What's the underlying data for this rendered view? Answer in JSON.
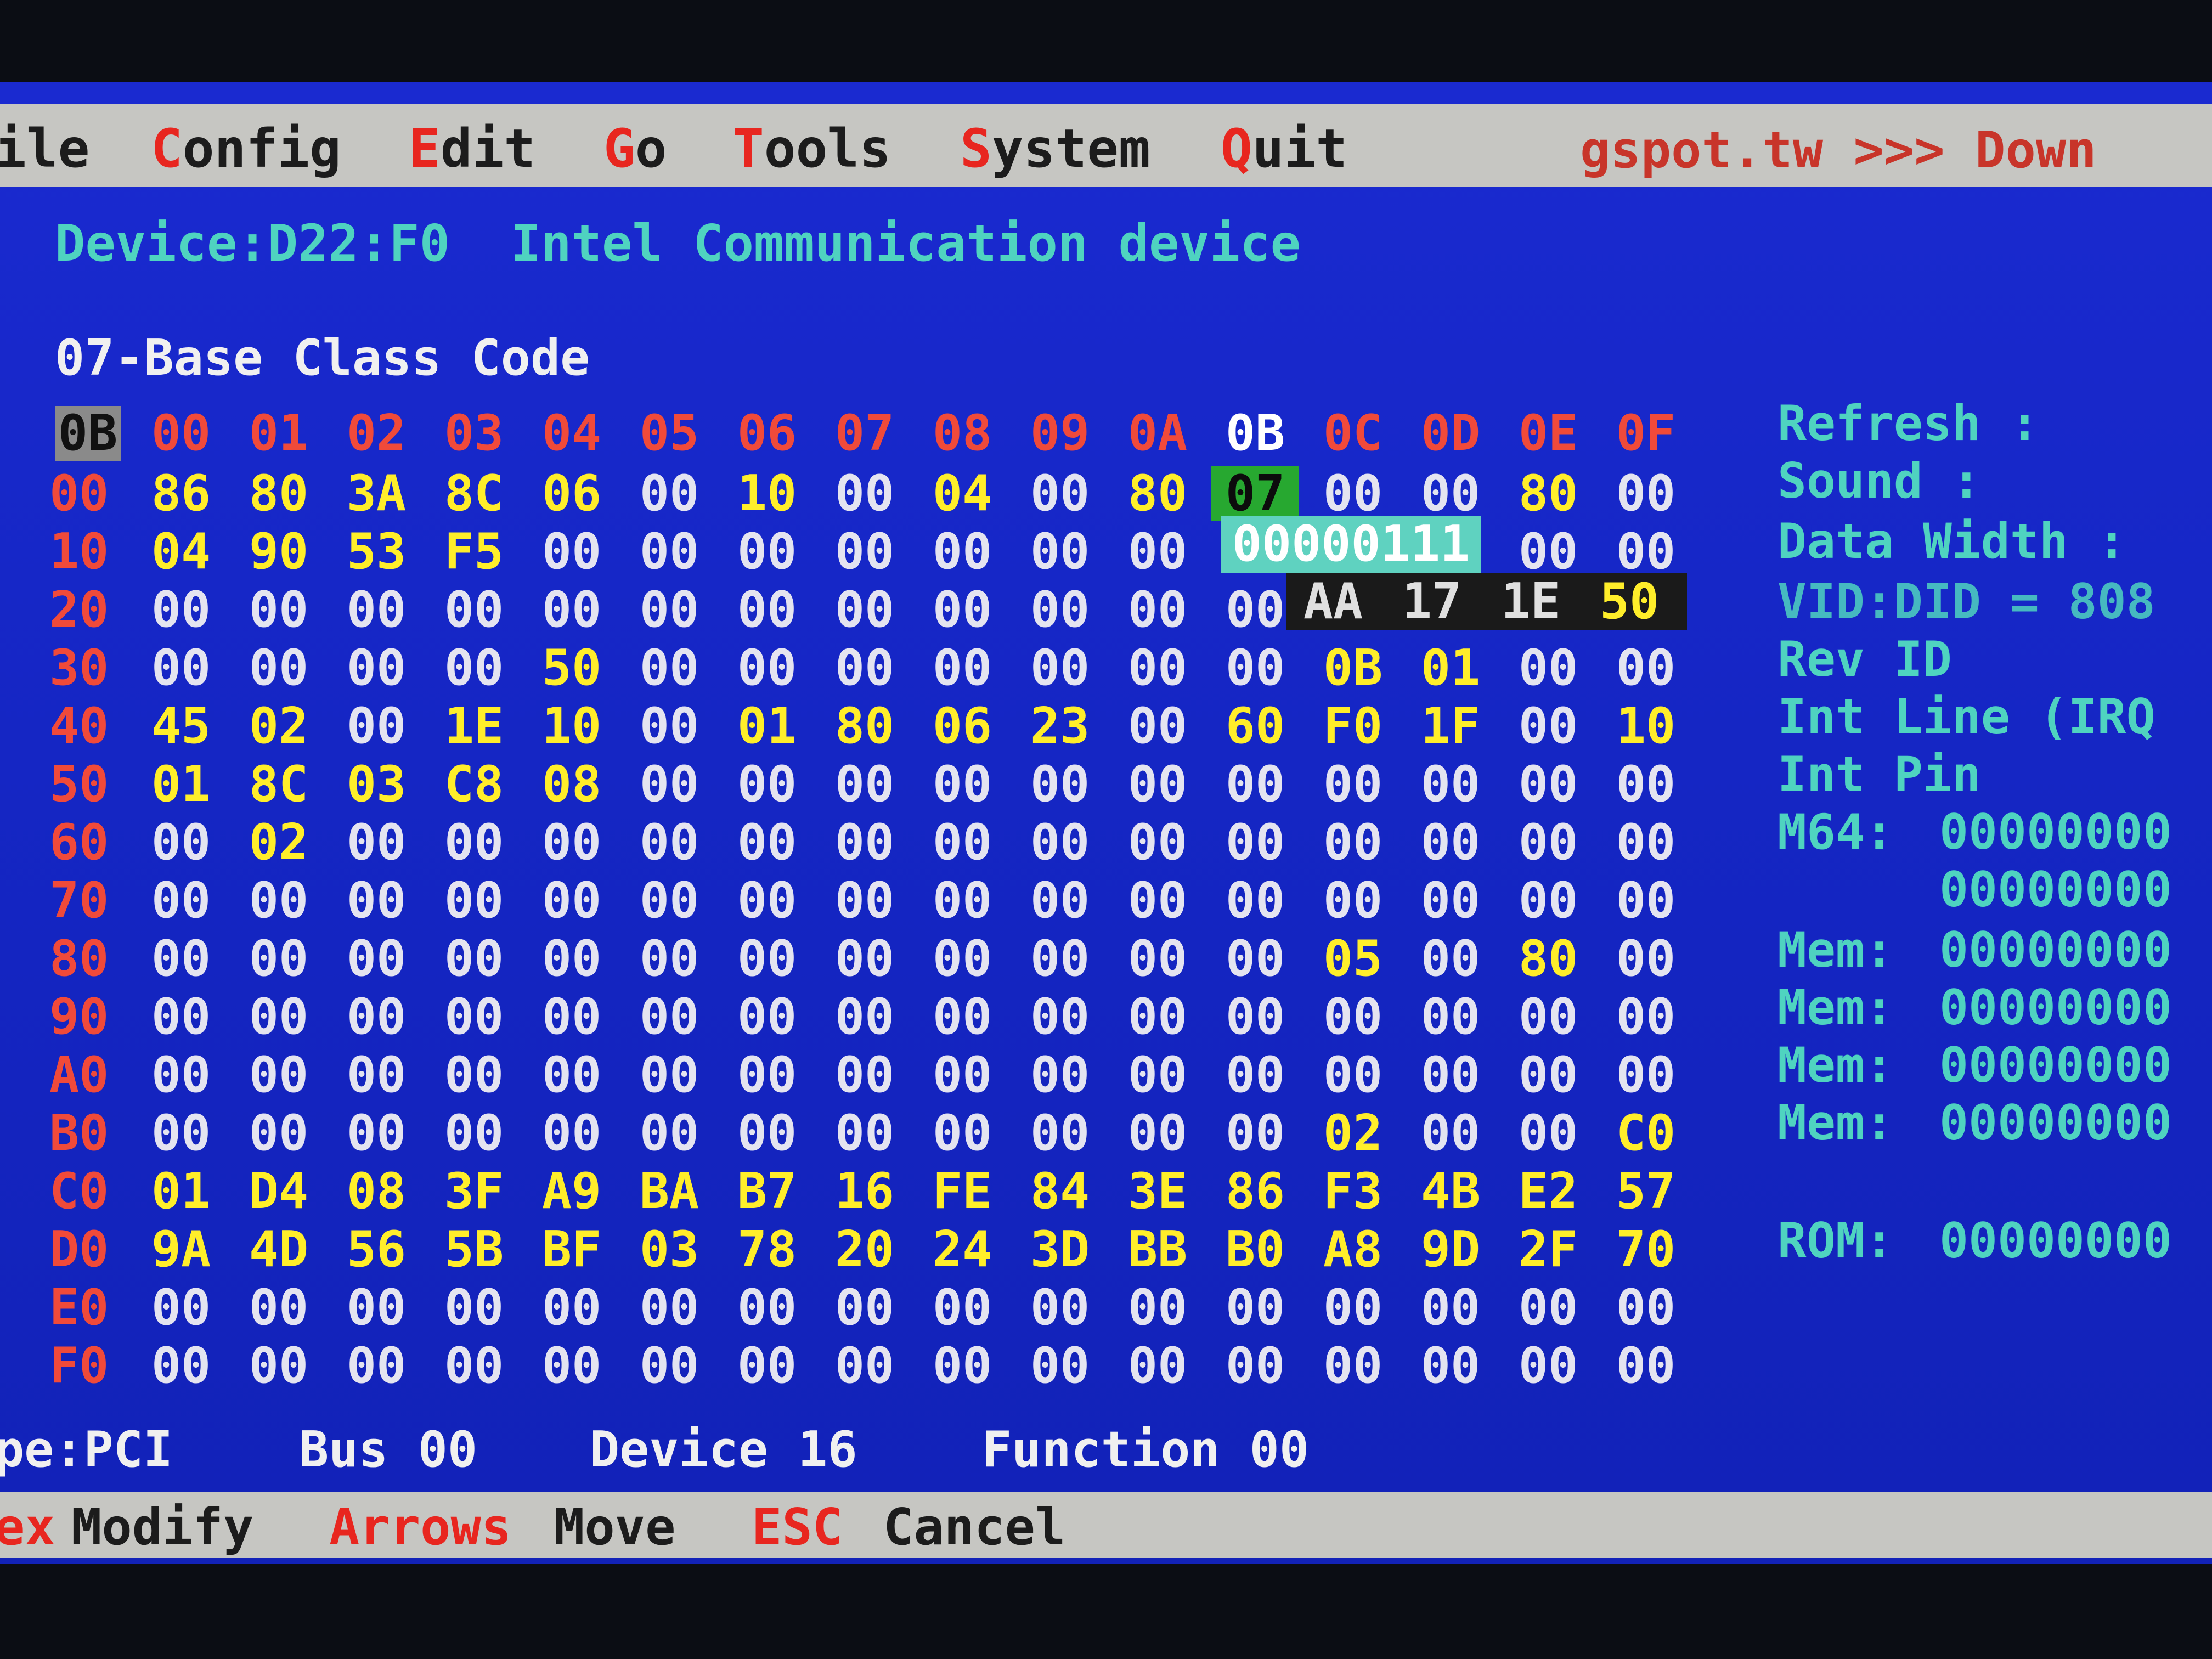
{
  "menu": {
    "items": [
      {
        "hot": "",
        "rest": "ile"
      },
      {
        "hot": "C",
        "rest": "onfig"
      },
      {
        "hot": "E",
        "rest": "dit"
      },
      {
        "hot": "G",
        "rest": "o"
      },
      {
        "hot": "T",
        "rest": "ools"
      },
      {
        "hot": "S",
        "rest": "ystem"
      },
      {
        "hot": "Q",
        "rest": "uit"
      }
    ],
    "brand": "gspot.tw",
    "brand_arrows": ">>>",
    "brand_tail": "Down"
  },
  "device": {
    "id": "Device:D22:F0",
    "vendor": "Intel",
    "description": "Communication device"
  },
  "register_title": "07-Base Class Code",
  "grid": {
    "selected_offset": "0B",
    "column_headers": [
      "00",
      "01",
      "02",
      "03",
      "04",
      "05",
      "06",
      "07",
      "08",
      "09",
      "0A",
      "0B",
      "0C",
      "0D",
      "0E",
      "0F"
    ],
    "rows": [
      {
        "label": "00",
        "cells": [
          "86",
          "80",
          "3A",
          "8C",
          "06",
          "00",
          "10",
          "00",
          "04",
          "00",
          "80",
          "07",
          "00",
          "00",
          "80",
          "00"
        ]
      },
      {
        "label": "10",
        "cells": [
          "04",
          "90",
          "53",
          "F5",
          "00",
          "00",
          "00",
          "00",
          "00",
          "00",
          "00",
          "",
          "",
          "",
          "00",
          "00"
        ]
      },
      {
        "label": "20",
        "cells": [
          "00",
          "00",
          "00",
          "00",
          "00",
          "00",
          "00",
          "00",
          "00",
          "00",
          "00",
          "00",
          "",
          "",
          "",
          ""
        ]
      },
      {
        "label": "30",
        "cells": [
          "00",
          "00",
          "00",
          "00",
          "50",
          "00",
          "00",
          "00",
          "00",
          "00",
          "00",
          "00",
          "0B",
          "01",
          "00",
          "00"
        ]
      },
      {
        "label": "40",
        "cells": [
          "45",
          "02",
          "00",
          "1E",
          "10",
          "00",
          "01",
          "80",
          "06",
          "23",
          "00",
          "60",
          "F0",
          "1F",
          "00",
          "10"
        ]
      },
      {
        "label": "50",
        "cells": [
          "01",
          "8C",
          "03",
          "C8",
          "08",
          "00",
          "00",
          "00",
          "00",
          "00",
          "00",
          "00",
          "00",
          "00",
          "00",
          "00"
        ]
      },
      {
        "label": "60",
        "cells": [
          "00",
          "02",
          "00",
          "00",
          "00",
          "00",
          "00",
          "00",
          "00",
          "00",
          "00",
          "00",
          "00",
          "00",
          "00",
          "00"
        ]
      },
      {
        "label": "70",
        "cells": [
          "00",
          "00",
          "00",
          "00",
          "00",
          "00",
          "00",
          "00",
          "00",
          "00",
          "00",
          "00",
          "00",
          "00",
          "00",
          "00"
        ]
      },
      {
        "label": "80",
        "cells": [
          "00",
          "00",
          "00",
          "00",
          "00",
          "00",
          "00",
          "00",
          "00",
          "00",
          "00",
          "00",
          "05",
          "00",
          "80",
          "00"
        ]
      },
      {
        "label": "90",
        "cells": [
          "00",
          "00",
          "00",
          "00",
          "00",
          "00",
          "00",
          "00",
          "00",
          "00",
          "00",
          "00",
          "00",
          "00",
          "00",
          "00"
        ]
      },
      {
        "label": "A0",
        "cells": [
          "00",
          "00",
          "00",
          "00",
          "00",
          "00",
          "00",
          "00",
          "00",
          "00",
          "00",
          "00",
          "00",
          "00",
          "00",
          "00"
        ]
      },
      {
        "label": "B0",
        "cells": [
          "00",
          "00",
          "00",
          "00",
          "00",
          "00",
          "00",
          "00",
          "00",
          "00",
          "00",
          "00",
          "02",
          "00",
          "00",
          "C0"
        ]
      },
      {
        "label": "C0",
        "cells": [
          "01",
          "D4",
          "08",
          "3F",
          "A9",
          "BA",
          "B7",
          "16",
          "FE",
          "84",
          "3E",
          "86",
          "F3",
          "4B",
          "E2",
          "57"
        ]
      },
      {
        "label": "D0",
        "cells": [
          "9A",
          "4D",
          "56",
          "5B",
          "BF",
          "03",
          "78",
          "20",
          "24",
          "3D",
          "BB",
          "B0",
          "A8",
          "9D",
          "2F",
          "70"
        ]
      },
      {
        "label": "E0",
        "cells": [
          "00",
          "00",
          "00",
          "00",
          "00",
          "00",
          "00",
          "00",
          "00",
          "00",
          "00",
          "00",
          "00",
          "00",
          "00",
          "00"
        ]
      },
      {
        "label": "F0",
        "cells": [
          "00",
          "00",
          "00",
          "00",
          "00",
          "00",
          "00",
          "00",
          "00",
          "00",
          "00",
          "00",
          "00",
          "00",
          "00",
          "00"
        ]
      }
    ]
  },
  "binary_tooltip": "00000111",
  "hex_tooltip": [
    "AA",
    "17",
    "1E",
    "50"
  ],
  "info_panel": {
    "refresh": "Refresh      :",
    "sound": "Sound        :",
    "data_width": "Data Width :",
    "vid_did": "VID:DID = 808",
    "rev_id": "Rev ID",
    "int_line": "Int Line (IRQ",
    "int_pin": "Int Pin",
    "m64_label": "M64:",
    "m64_value1": "00000000",
    "m64_value2": "00000000",
    "mem_label": "Mem:",
    "mem_values": [
      "00000000",
      "00000000",
      "00000000",
      "00000000"
    ],
    "rom_label": "ROM:",
    "rom_value": "00000000"
  },
  "status": {
    "type": "pe:PCI",
    "bus": "Bus 00",
    "device": "Device 16",
    "function": "Function 00"
  },
  "hints": [
    {
      "key": "ex",
      "label": "Modify"
    },
    {
      "key": "Arrows",
      "label": "Move"
    },
    {
      "key": "ESC",
      "label": "Cancel"
    }
  ],
  "colors": {
    "screen_blue": "#1526c4",
    "menu_gray": "#c6c6c2",
    "hotkey_red": "#e8261f",
    "header_red": "#f04a3a",
    "nonzero_yellow": "#ffee2a",
    "info_cyan": "#4fd3c0",
    "selection_green": "#27a830"
  }
}
